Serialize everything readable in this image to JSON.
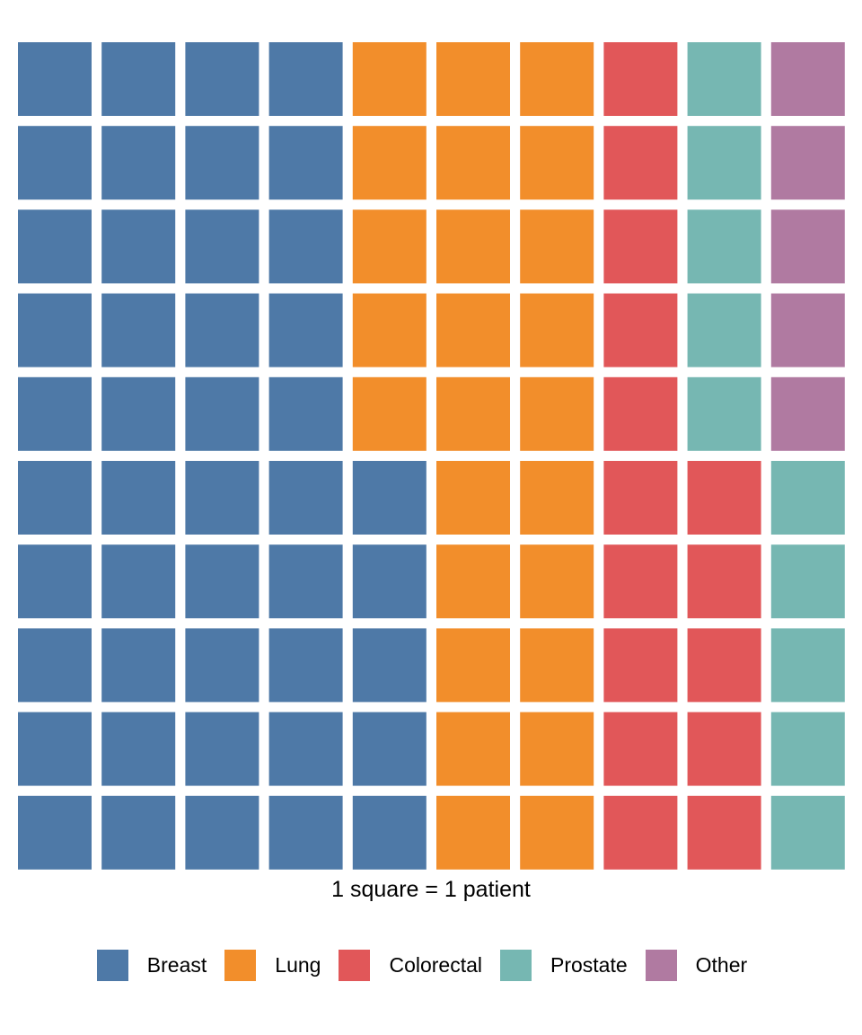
{
  "chart_data": {
    "type": "waffle",
    "title": "",
    "caption": "1 square = 1 patient",
    "unit": "1 square = 1 patient",
    "grid": {
      "rows": 10,
      "columns": 10,
      "fill_order": "column-major, bottom-to-top"
    },
    "legend_position": "bottom",
    "series": [
      {
        "name": "Breast",
        "value": 45,
        "color": "#4e79a7"
      },
      {
        "name": "Lung",
        "value": 25,
        "color": "#f28e2b"
      },
      {
        "name": "Colorectal",
        "value": 15,
        "color": "#e15759"
      },
      {
        "name": "Prostate",
        "value": 10,
        "color": "#76b7b2"
      },
      {
        "name": "Other",
        "value": 5,
        "color": "#b07aa1"
      }
    ]
  },
  "legend": {
    "items": [
      {
        "label": "Breast",
        "color": "#4e79a7"
      },
      {
        "label": "Lung",
        "color": "#f28e2b"
      },
      {
        "label": "Colorectal",
        "color": "#e15759"
      },
      {
        "label": "Prostate",
        "color": "#76b7b2"
      },
      {
        "label": "Other",
        "color": "#b07aa1"
      }
    ]
  }
}
